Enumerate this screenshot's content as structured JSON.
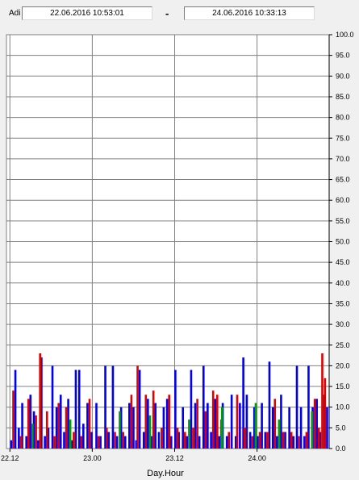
{
  "toolbar": {
    "label": "Adi",
    "from_value": "22.06.2016    10:53:01",
    "separator": "-",
    "to_value": "24.06.2016    10:33:13"
  },
  "chart_data": {
    "type": "bar",
    "xlabel": "Day.Hour",
    "ylabel": "",
    "ylim": [
      0,
      100
    ],
    "y_ticks": [
      "0.0",
      "5.0",
      "10.0",
      "15.0",
      "20.0",
      "25.0",
      "30.0",
      "35.0",
      "40.0",
      "45.0",
      "50.0",
      "55.0",
      "60.0",
      "65.0",
      "70.0",
      "75.0",
      "80.0",
      "85.0",
      "90.0",
      "95.0",
      "100.0"
    ],
    "x_ticks": [
      "22.12",
      "23.00",
      "23.12",
      "24.00"
    ],
    "x_tick_positions": [
      0,
      12,
      24,
      36
    ],
    "xlim": [
      -0.5,
      46.5
    ],
    "grid": true,
    "series": [
      {
        "color": "#0000ee",
        "values": [
          [
            0.2,
            2
          ],
          [
            0.8,
            19
          ],
          [
            1.3,
            5
          ],
          [
            1.8,
            11
          ],
          [
            2.4,
            3
          ],
          [
            3.0,
            13
          ],
          [
            3.5,
            9
          ],
          [
            4.1,
            2
          ],
          [
            4.6,
            22
          ],
          [
            5.1,
            3
          ],
          [
            5.6,
            5
          ],
          [
            6.2,
            20
          ],
          [
            6.8,
            10
          ],
          [
            7.4,
            13
          ],
          [
            7.9,
            4
          ],
          [
            8.5,
            12
          ],
          [
            9.1,
            2
          ],
          [
            9.6,
            19
          ],
          [
            10.1,
            19
          ],
          [
            10.7,
            6
          ],
          [
            11.3,
            11
          ],
          [
            11.9,
            4
          ],
          [
            12.6,
            11
          ],
          [
            13.2,
            3
          ],
          [
            13.9,
            20
          ],
          [
            14.4,
            4
          ],
          [
            15.0,
            20
          ],
          [
            15.6,
            3
          ],
          [
            16.2,
            10
          ],
          [
            16.8,
            3
          ],
          [
            17.4,
            11
          ],
          [
            18.0,
            10
          ],
          [
            18.4,
            2
          ],
          [
            18.9,
            19
          ],
          [
            19.5,
            4
          ],
          [
            20.1,
            12
          ],
          [
            20.6,
            3
          ],
          [
            21.2,
            11
          ],
          [
            21.7,
            4
          ],
          [
            22.4,
            10
          ],
          [
            22.9,
            12
          ],
          [
            23.5,
            3
          ],
          [
            24.1,
            19
          ],
          [
            24.6,
            4
          ],
          [
            25.2,
            10
          ],
          [
            25.8,
            3
          ],
          [
            26.4,
            19
          ],
          [
            27.0,
            11
          ],
          [
            27.6,
            3
          ],
          [
            28.2,
            20
          ],
          [
            28.8,
            11
          ],
          [
            29.3,
            4
          ],
          [
            29.9,
            12
          ],
          [
            30.5,
            3
          ],
          [
            31.0,
            11
          ],
          [
            31.6,
            3
          ],
          [
            32.3,
            13
          ],
          [
            32.9,
            3
          ],
          [
            33.5,
            11
          ],
          [
            34.0,
            22
          ],
          [
            34.5,
            13
          ],
          [
            35.0,
            4
          ],
          [
            35.6,
            10
          ],
          [
            36.1,
            3
          ],
          [
            36.7,
            11
          ],
          [
            37.2,
            4
          ],
          [
            37.8,
            21
          ],
          [
            38.3,
            10
          ],
          [
            38.9,
            3
          ],
          [
            39.5,
            13
          ],
          [
            40.1,
            4
          ],
          [
            40.7,
            10
          ],
          [
            41.3,
            3
          ],
          [
            41.8,
            20
          ],
          [
            42.4,
            10
          ],
          [
            42.9,
            3
          ],
          [
            43.5,
            20
          ],
          [
            44.1,
            10
          ],
          [
            44.7,
            12
          ],
          [
            45.2,
            4
          ],
          [
            45.8,
            13
          ],
          [
            46.2,
            10
          ]
        ]
      },
      {
        "color": "#e00000",
        "values": [
          [
            0.5,
            14
          ],
          [
            1.6,
            3
          ],
          [
            2.7,
            12
          ],
          [
            3.8,
            8
          ],
          [
            4.4,
            23
          ],
          [
            5.4,
            9
          ],
          [
            6.5,
            3
          ],
          [
            7.1,
            11
          ],
          [
            8.2,
            10
          ],
          [
            9.3,
            4
          ],
          [
            10.4,
            3
          ],
          [
            11.6,
            12
          ],
          [
            12.9,
            3
          ],
          [
            14.1,
            5
          ],
          [
            15.3,
            4
          ],
          [
            16.5,
            4
          ],
          [
            17.7,
            13
          ],
          [
            18.6,
            20
          ],
          [
            19.8,
            13
          ],
          [
            20.9,
            14
          ],
          [
            22.1,
            5
          ],
          [
            23.2,
            13
          ],
          [
            24.4,
            5
          ],
          [
            25.5,
            4
          ],
          [
            26.7,
            5
          ],
          [
            27.3,
            12
          ],
          [
            28.5,
            9
          ],
          [
            29.6,
            14
          ],
          [
            30.2,
            13
          ],
          [
            30.8,
            7
          ],
          [
            31.9,
            4
          ],
          [
            33.1,
            13
          ],
          [
            34.2,
            5
          ],
          [
            35.3,
            3
          ],
          [
            36.4,
            4
          ],
          [
            37.5,
            4
          ],
          [
            38.6,
            12
          ],
          [
            39.8,
            4
          ],
          [
            41.0,
            4
          ],
          [
            42.1,
            3
          ],
          [
            43.2,
            4
          ],
          [
            44.4,
            12
          ],
          [
            45.0,
            5
          ],
          [
            45.5,
            23
          ],
          [
            45.9,
            17
          ]
        ]
      },
      {
        "color": "#00a000",
        "values": [
          [
            3.3,
            6
          ],
          [
            8.8,
            7
          ],
          [
            16.0,
            9
          ],
          [
            20.4,
            8
          ],
          [
            26.1,
            7
          ],
          [
            30.9,
            10
          ],
          [
            35.8,
            11
          ],
          [
            39.2,
            7
          ],
          [
            44.0,
            9
          ]
        ]
      }
    ]
  }
}
